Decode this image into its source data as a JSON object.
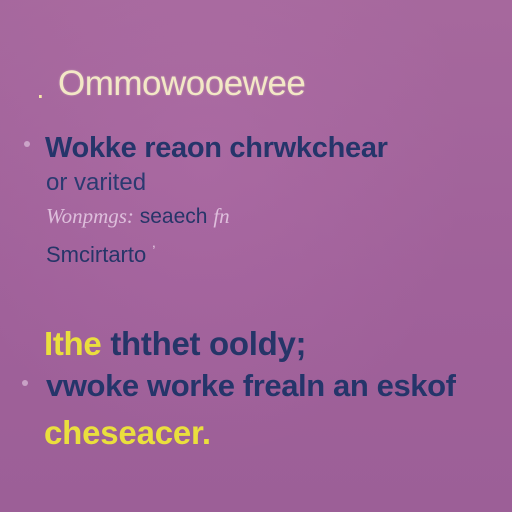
{
  "heading": {
    "bullet": "․",
    "text": "Ommowooewee"
  },
  "lines": {
    "line1": "Wokke reaon  chrwkchear",
    "line2": "or varited",
    "line3_faded": "Wonpmgs:",
    "line3_text": "seaech",
    "line3_tail": "fn",
    "line4": "Smcirtarto",
    "line4_tick": "ʼ",
    "line5_highlight": "Ithe",
    "line5_text": "ththet ooldy;",
    "line6": "vwoke worke frealn an eskof",
    "line7": "cheseacer."
  },
  "colors": {
    "background": "#a2639a",
    "text_dark": "#25356a",
    "highlight_yellow": "#eadf3d",
    "title_cream": "#f3e8c6"
  }
}
